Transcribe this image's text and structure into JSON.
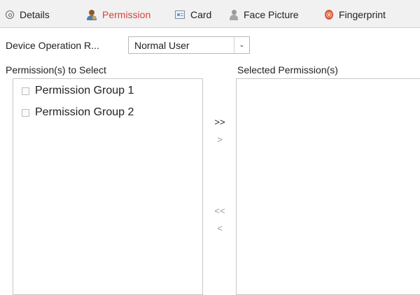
{
  "tabs": [
    {
      "label": "Details",
      "icon": "gear-icon"
    },
    {
      "label": "Permission",
      "icon": "user-permission-icon"
    },
    {
      "label": "Card",
      "icon": "card-icon"
    },
    {
      "label": "Face Picture",
      "icon": "face-icon"
    },
    {
      "label": "Fingerprint",
      "icon": "fingerprint-icon"
    }
  ],
  "active_tab": "Permission",
  "active_color": "#d9413a",
  "device_operation": {
    "label": "Device Operation R...",
    "selected": "Normal User"
  },
  "available": {
    "header": "Permission(s) to Select",
    "items": [
      "Permission Group 1",
      "Permission Group 2"
    ]
  },
  "selected": {
    "header": "Selected Permission(s)",
    "items": []
  },
  "move_buttons": {
    "add_all": ">>",
    "add": ">",
    "remove_all": "<<",
    "remove": "<"
  }
}
